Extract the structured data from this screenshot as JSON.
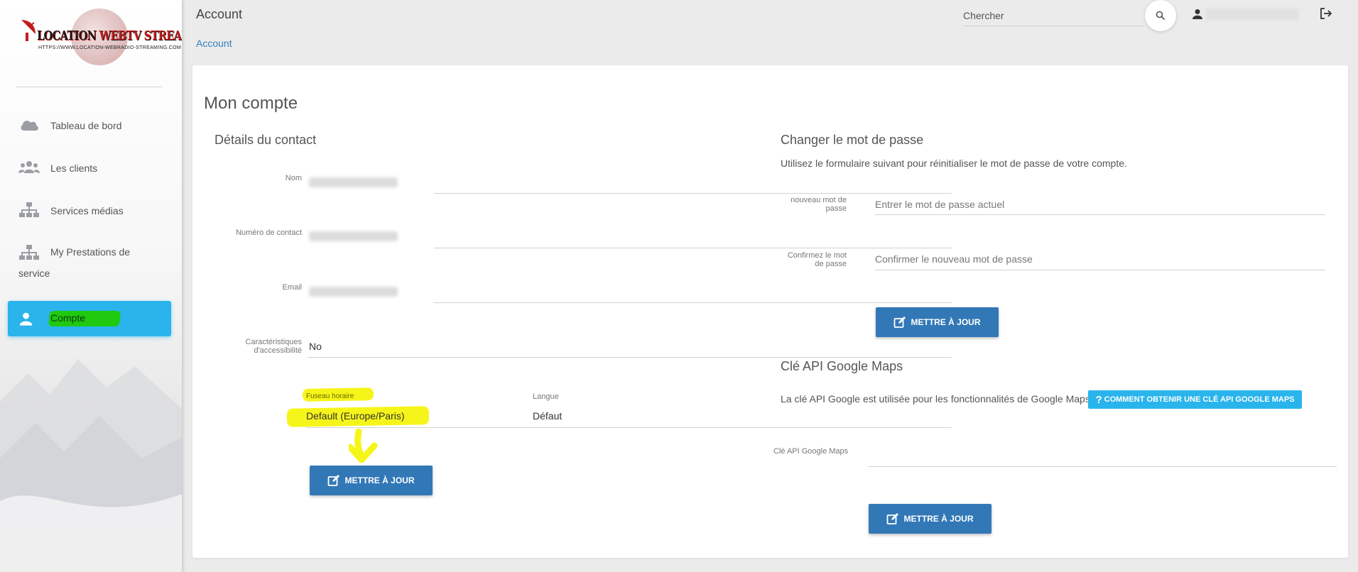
{
  "colors": {
    "accent": "#2ab4ec",
    "primary_button": "#3278b7",
    "link": "#2f7ec2",
    "highlight_yellow": "#f6f51a",
    "highlight_green": "#20c90e"
  },
  "brand": {
    "name_part1": "LOCATION ",
    "name_part2": "WEBTV STREAMING",
    "url": "HTTPS://WWW.LOCATION-WEBRADIO-STREAMING.COM"
  },
  "sidebar": {
    "items": [
      {
        "label": "Tableau de bord",
        "icon": "cloud-icon"
      },
      {
        "label": "Les clients",
        "icon": "users-icon"
      },
      {
        "label": "Services médias",
        "icon": "sitemap-icon"
      },
      {
        "label": "My Prestations de",
        "label_line2": "service",
        "icon": "sitemap-icon"
      },
      {
        "label": "Compte",
        "icon": "user-icon",
        "active": true
      }
    ]
  },
  "header": {
    "title": "Account",
    "breadcrumb": "Account",
    "search_placeholder": "Chercher",
    "search_icon": "search-icon",
    "user_icon": "user-icon",
    "logout_icon": "logout-icon"
  },
  "main": {
    "title": "Mon compte",
    "contact": {
      "title": "Détails du contact",
      "name_label": "Nom",
      "phone_label": "Numéro de contact",
      "email_label": "Email",
      "accessibility_label": "Caractéristiques d'accessibilité",
      "accessibility_value": "No",
      "timezone_label": "Fuseau horaire",
      "timezone_value": "Default (Europe/Paris)",
      "language_label": "Langue",
      "language_value": "Défaut",
      "update_button": "METTRE À JOUR"
    },
    "password": {
      "title": "Changer le mot de passe",
      "description": "Utilisez le formulaire suivant pour réinitialiser le mot de passe de votre compte.",
      "new_label": "nouveau mot de passe",
      "new_placeholder": "Entrer le mot de passe actuel",
      "confirm_label": "Confirmez le mot de passe",
      "confirm_placeholder": "Confirmer le nouveau mot de passe",
      "update_button": "METTRE À JOUR"
    },
    "maps": {
      "title": "Clé API Google Maps",
      "description": "La clé API Google est utilisée pour les fonctionnalités de Google Maps.",
      "help_button": "COMMENT OBTENIR UNE CLÉ API GOOGLE MAPS",
      "key_label": "Clé API Google Maps",
      "update_button": "METTRE À JOUR"
    }
  }
}
